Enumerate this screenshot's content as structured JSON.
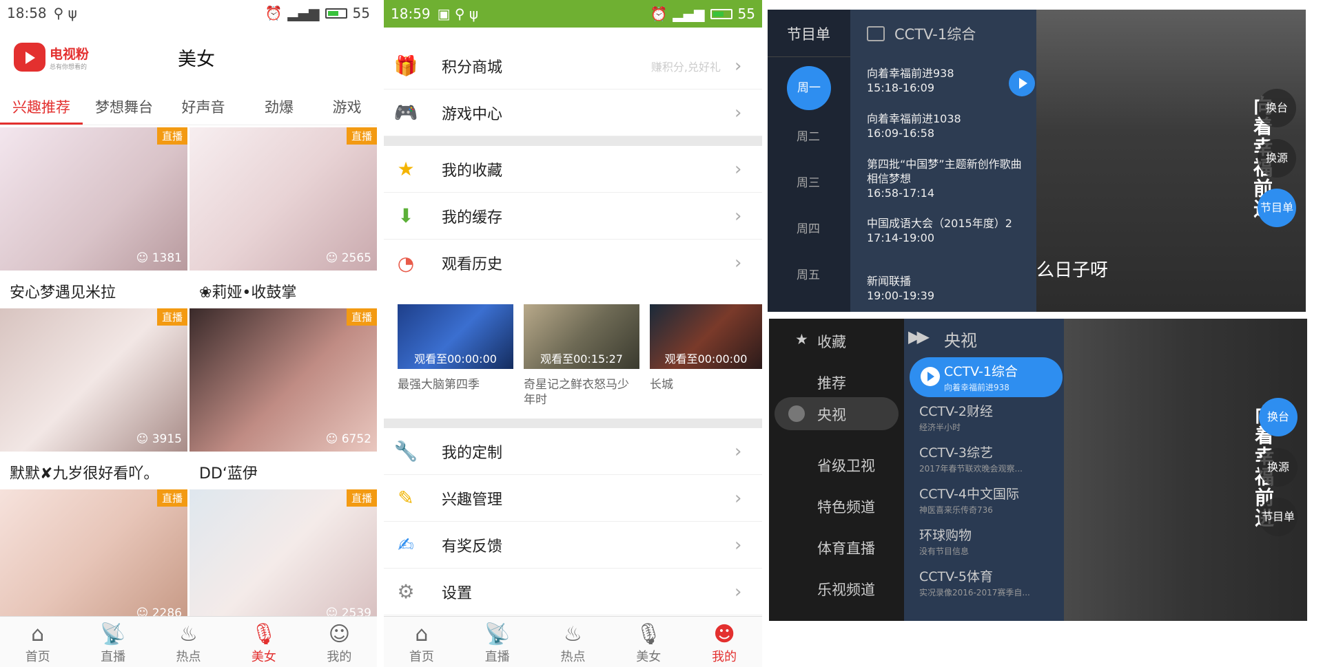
{
  "p1": {
    "status": {
      "time": "18:58",
      "battery": "55"
    },
    "app_name": "电视粉",
    "app_slogan": "总有你想看的",
    "title": "美女",
    "tabs": [
      "兴趣推荐",
      "梦想舞台",
      "好声音",
      "劲爆",
      "游戏"
    ],
    "badge": "直播",
    "cards": [
      {
        "name": "安心梦遇见米拉",
        "viewers": "1381"
      },
      {
        "name": "❀莉娅•收鼓掌",
        "viewers": "2565"
      },
      {
        "name": "默默✘九岁很好看吖。",
        "viewers": "3915"
      },
      {
        "name": "DD‘蓝伊",
        "viewers": "6752"
      },
      {
        "name": "",
        "viewers": "2286"
      },
      {
        "name": "",
        "viewers": "2539"
      }
    ],
    "tabbar": [
      "首页",
      "直播",
      "热点",
      "美女",
      "我的"
    ]
  },
  "p2": {
    "status": {
      "time": "18:59",
      "battery": "55"
    },
    "menu1": [
      {
        "label": "积分商城",
        "hint": "赚积分,兑好礼"
      },
      {
        "label": "游戏中心",
        "hint": ""
      }
    ],
    "menu2": [
      {
        "label": "我的收藏"
      },
      {
        "label": "我的缓存"
      },
      {
        "label": "观看历史"
      }
    ],
    "history": [
      {
        "title": "最强大脑第四季",
        "progress": "观看至00:00:00"
      },
      {
        "title": "奇星记之鲜衣怒马少年时",
        "progress": "观看至00:15:27"
      },
      {
        "title": "长城",
        "progress": "观看至00:00:00"
      }
    ],
    "menu3": [
      {
        "label": "我的定制"
      },
      {
        "label": "兴趣管理"
      },
      {
        "label": "有奖反馈"
      },
      {
        "label": "设置"
      }
    ],
    "tabbar": [
      "首页",
      "直播",
      "热点",
      "美女",
      "我的"
    ]
  },
  "p3": {
    "header": "节目单",
    "channel": "CCTV-1综合",
    "days": [
      "周一",
      "周二",
      "周三",
      "周四",
      "周五"
    ],
    "programs": [
      {
        "name": "向着幸福前进938",
        "time": "15:18-16:09"
      },
      {
        "name": "向着幸福前进1038",
        "time": "16:09-16:58"
      },
      {
        "name": "第四批“中国梦”主题新创作歌曲相信梦想",
        "time": "16:58-17:14"
      },
      {
        "name": "中国成语大会（2015年度）2",
        "time": "17:14-19:00"
      },
      {
        "name": "新闻联播",
        "time": "19:00-19:39"
      }
    ],
    "buttons": [
      "换台",
      "换源",
      "节目单"
    ],
    "overlay_text": "向着幸福前进",
    "subtitle": "么日子呀"
  },
  "p4": {
    "categories": [
      "收藏",
      "推荐",
      "央视",
      "省级卫视",
      "特色频道",
      "体育直播",
      "乐视频道"
    ],
    "group_title": "央视",
    "channels": [
      {
        "name": "CCTV-1综合",
        "now": "向着幸福前进938"
      },
      {
        "name": "CCTV-2财经",
        "now": "经济半小时"
      },
      {
        "name": "CCTV-3综艺",
        "now": "2017年春节联欢晚会观察..."
      },
      {
        "name": "CCTV-4中文国际",
        "now": "神医喜来乐传奇736"
      },
      {
        "name": "环球购物",
        "now": "没有节目信息"
      },
      {
        "name": "CCTV-5体育",
        "now": "实况录像2016-2017赛季自..."
      }
    ],
    "buttons": [
      "换台",
      "换源",
      "节目单"
    ],
    "overlay_text": "向着幸福前进"
  }
}
